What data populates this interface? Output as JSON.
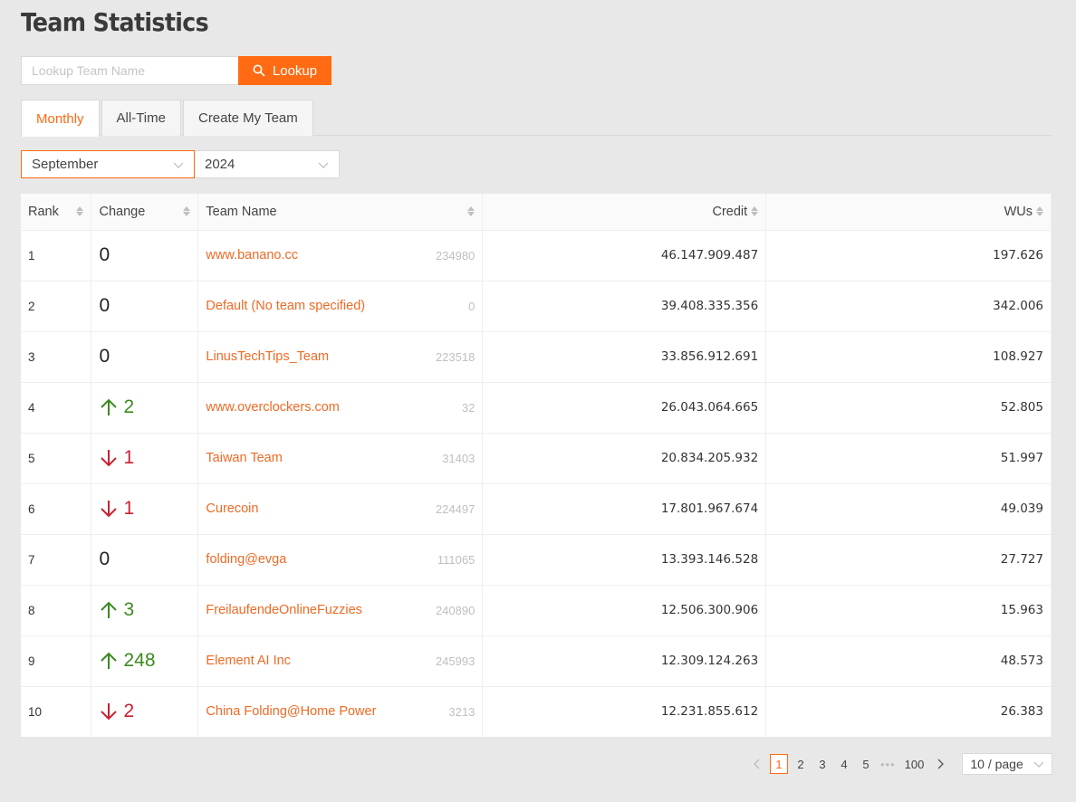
{
  "page": {
    "title": "Team Statistics"
  },
  "search": {
    "placeholder": "Lookup Team Name",
    "button_label": "Lookup"
  },
  "tabs": [
    {
      "label": "Monthly"
    },
    {
      "label": "All-Time"
    },
    {
      "label": "Create My Team"
    }
  ],
  "filters": {
    "month": "September",
    "year": "2024"
  },
  "table": {
    "columns": [
      "Rank",
      "Change",
      "Team Name",
      "Credit",
      "WUs"
    ],
    "rows": [
      {
        "rank": "1",
        "change": "0",
        "direction": "none",
        "team": "www.banano.cc",
        "team_id": "234980",
        "credit": "46.147.909.487",
        "wus": "197.626"
      },
      {
        "rank": "2",
        "change": "0",
        "direction": "none",
        "team": "Default (No team specified)",
        "team_id": "0",
        "credit": "39.408.335.356",
        "wus": "342.006"
      },
      {
        "rank": "3",
        "change": "0",
        "direction": "none",
        "team": "LinusTechTips_Team",
        "team_id": "223518",
        "credit": "33.856.912.691",
        "wus": "108.927"
      },
      {
        "rank": "4",
        "change": "2",
        "direction": "up",
        "team": "www.overclockers.com",
        "team_id": "32",
        "credit": "26.043.064.665",
        "wus": "52.805"
      },
      {
        "rank": "5",
        "change": "1",
        "direction": "down",
        "team": "Taiwan Team",
        "team_id": "31403",
        "credit": "20.834.205.932",
        "wus": "51.997"
      },
      {
        "rank": "6",
        "change": "1",
        "direction": "down",
        "team": "Curecoin",
        "team_id": "224497",
        "credit": "17.801.967.674",
        "wus": "49.039"
      },
      {
        "rank": "7",
        "change": "0",
        "direction": "none",
        "team": "folding@evga",
        "team_id": "111065",
        "credit": "13.393.146.528",
        "wus": "27.727"
      },
      {
        "rank": "8",
        "change": "3",
        "direction": "up",
        "team": "FreilaufendeOnlineFuzzies",
        "team_id": "240890",
        "credit": "12.506.300.906",
        "wus": "15.963"
      },
      {
        "rank": "9",
        "change": "248",
        "direction": "up",
        "team": "Element AI Inc",
        "team_id": "245993",
        "credit": "12.309.124.263",
        "wus": "48.573"
      },
      {
        "rank": "10",
        "change": "2",
        "direction": "down",
        "team": "China Folding@Home Power",
        "team_id": "3213",
        "credit": "12.231.855.612",
        "wus": "26.383"
      }
    ]
  },
  "pagination": {
    "pages": [
      "1",
      "2",
      "3",
      "4",
      "5"
    ],
    "ellipsis": "•••",
    "last": "100",
    "page_size": "10 / page"
  },
  "colors": {
    "accent": "#ff6a13",
    "up": "#3b8a1e",
    "down": "#cc1f2f"
  },
  "icons": {
    "search": "search-icon",
    "up": "arrow-up-icon",
    "down": "arrow-down-icon",
    "chevron": "chevron-down-icon"
  }
}
